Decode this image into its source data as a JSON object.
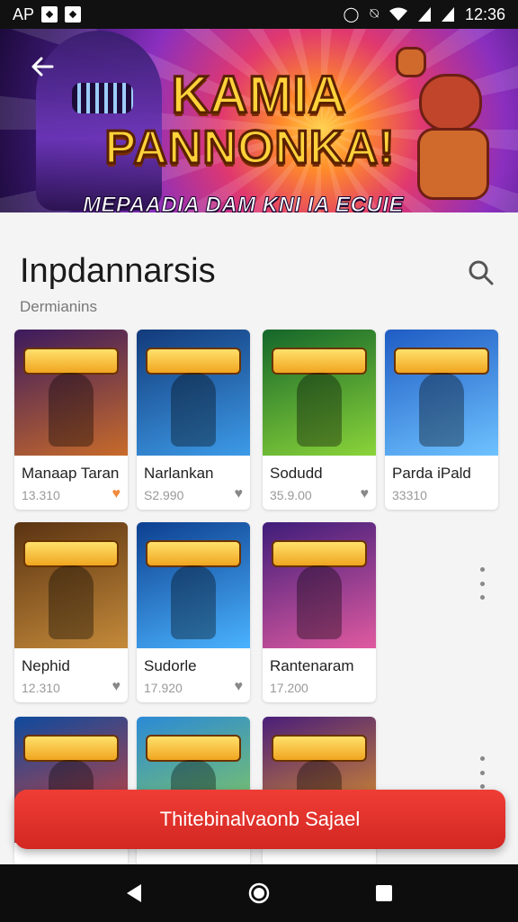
{
  "status_bar": {
    "app_label": "AP",
    "time": "12:36",
    "icons": [
      "notification-icon",
      "notification-icon",
      "alarm-icon",
      "vibrate-icon",
      "wifi-icon",
      "signal-icon",
      "signal-icon"
    ]
  },
  "banner": {
    "title_line1": "KAMIA",
    "title_line2": "PANNONKA!",
    "subtitle": "MEPAADIA DAM KNI IA ECUIE LNDESKNI",
    "back_icon": "arrow-left-icon"
  },
  "section": {
    "title": "Inpdannarsis",
    "subtitle": "Dermianins",
    "search_icon": "search-icon"
  },
  "games": [
    {
      "name": "Manaap Taran",
      "meta": "13.310",
      "favorited": true,
      "colors": [
        "#3b1a5e",
        "#c86b2a"
      ]
    },
    {
      "name": "Narlankan",
      "meta": "S2.990",
      "favorited": false,
      "colors": [
        "#123a7a",
        "#3d9be8"
      ]
    },
    {
      "name": "Sodudd",
      "meta": "35.9.00",
      "favorited": false,
      "colors": [
        "#14662a",
        "#8bd43a"
      ]
    },
    {
      "name": "Parda iPald",
      "meta": "33310",
      "favorited": false,
      "colors": [
        "#1f5cc4",
        "#6ec2ff"
      ]
    },
    {
      "name": "Nephid",
      "meta": "12.310",
      "favorited": false,
      "colors": [
        "#5a3312",
        "#c48a3a"
      ]
    },
    {
      "name": "Sudorle",
      "meta": "17.920",
      "favorited": false,
      "colors": [
        "#0d3f8f",
        "#4ab3ff"
      ]
    },
    {
      "name": "Rantenaram",
      "meta": "17.200",
      "favorited": false,
      "colors": [
        "#3e1d7a",
        "#e05aa0"
      ]
    },
    {
      "name": "",
      "meta": "",
      "favorited": false,
      "colors": [
        "#0e4a9e",
        "#e04030"
      ]
    },
    {
      "name": "",
      "meta": "",
      "favorited": false,
      "colors": [
        "#2b8ad6",
        "#8fd14f"
      ]
    },
    {
      "name": "",
      "meta": "",
      "favorited": false,
      "colors": [
        "#4a1e7a",
        "#f0a020"
      ]
    }
  ],
  "cta": {
    "label": "Thitebinalvaonb Sajael"
  },
  "nav": {
    "back_icon": "triangle-back-icon",
    "home_icon": "circle-home-icon",
    "recents_icon": "square-recents-icon"
  },
  "colors": {
    "accent": "#e3302a",
    "status_bar": "#111111",
    "nav_bar": "#0d0d0d"
  }
}
